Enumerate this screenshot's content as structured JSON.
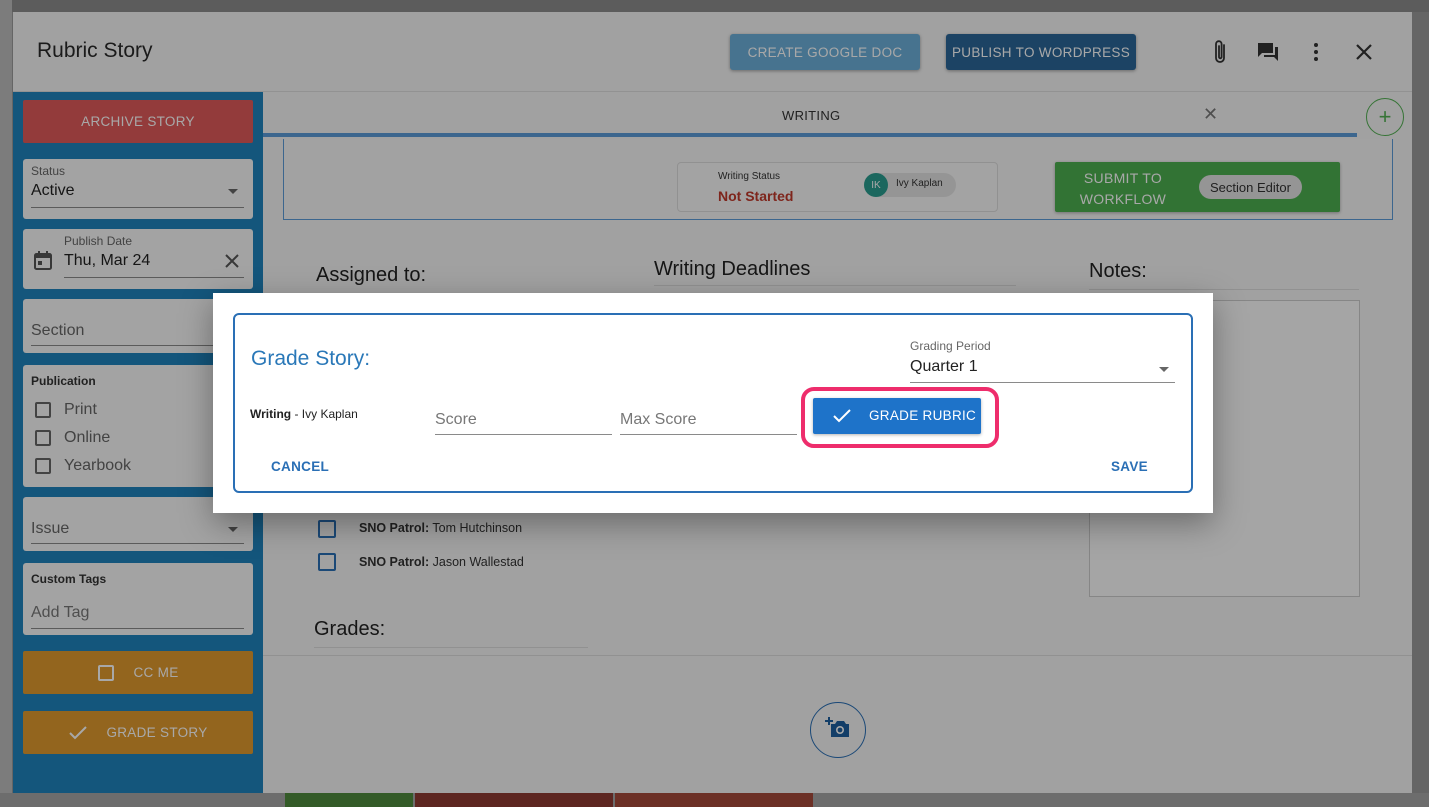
{
  "window": {
    "title": "Rubric Story",
    "create_google_doc": "CREATE GOOGLE DOC",
    "publish_wordpress": "PUBLISH TO WORDPRESS"
  },
  "sidebar": {
    "archive_label": "ARCHIVE STORY",
    "status_label": "Status",
    "status_value": "Active",
    "publish_date_label": "Publish Date",
    "publish_date_value": "Thu, Mar 24",
    "section_placeholder": "Section",
    "publication_label": "Publication",
    "publications": [
      "Print",
      "Online",
      "Yearbook"
    ],
    "issue_placeholder": "Issue",
    "custom_tags_label": "Custom Tags",
    "add_tag_placeholder": "Add Tag",
    "cc_me_label": "CC ME",
    "grade_story_label": "GRADE STORY"
  },
  "main": {
    "tab_label": "WRITING",
    "writing_status_label": "Writing Status",
    "writing_status_value": "Not Started",
    "assignee_initials": "IK",
    "assignee_name": "Ivy Kaplan",
    "submit_label": "SUBMIT TO WORKFLOW",
    "submit_chip": "Section Editor",
    "assigned_heading": "Assigned to:",
    "deadlines_heading": "Writing Deadlines",
    "notes_heading": "Notes:",
    "grades_heading": "Grades:",
    "patrol": [
      {
        "role": "SNO Patrol:",
        "name": "Tom Hutchinson"
      },
      {
        "role": "SNO Patrol:",
        "name": "Jason Wallestad"
      }
    ]
  },
  "dialog": {
    "title": "Grade Story:",
    "grading_period_label": "Grading Period",
    "grading_period_value": "Quarter 1",
    "writing_role": "Writing",
    "writing_person": " - Ivy Kaplan",
    "score_placeholder": "Score",
    "max_score_placeholder": "Max Score",
    "grade_rubric_label": "GRADE RUBRIC",
    "cancel_label": "CANCEL",
    "save_label": "SAVE"
  },
  "colors": {
    "sidebar_blue": "#1f83bd",
    "archive_red": "#e05a5a",
    "orange": "#e09a2e",
    "highlight_pink": "#ee2d6c",
    "primary_blue": "#1e73c9",
    "submit_green": "#4caf50"
  }
}
